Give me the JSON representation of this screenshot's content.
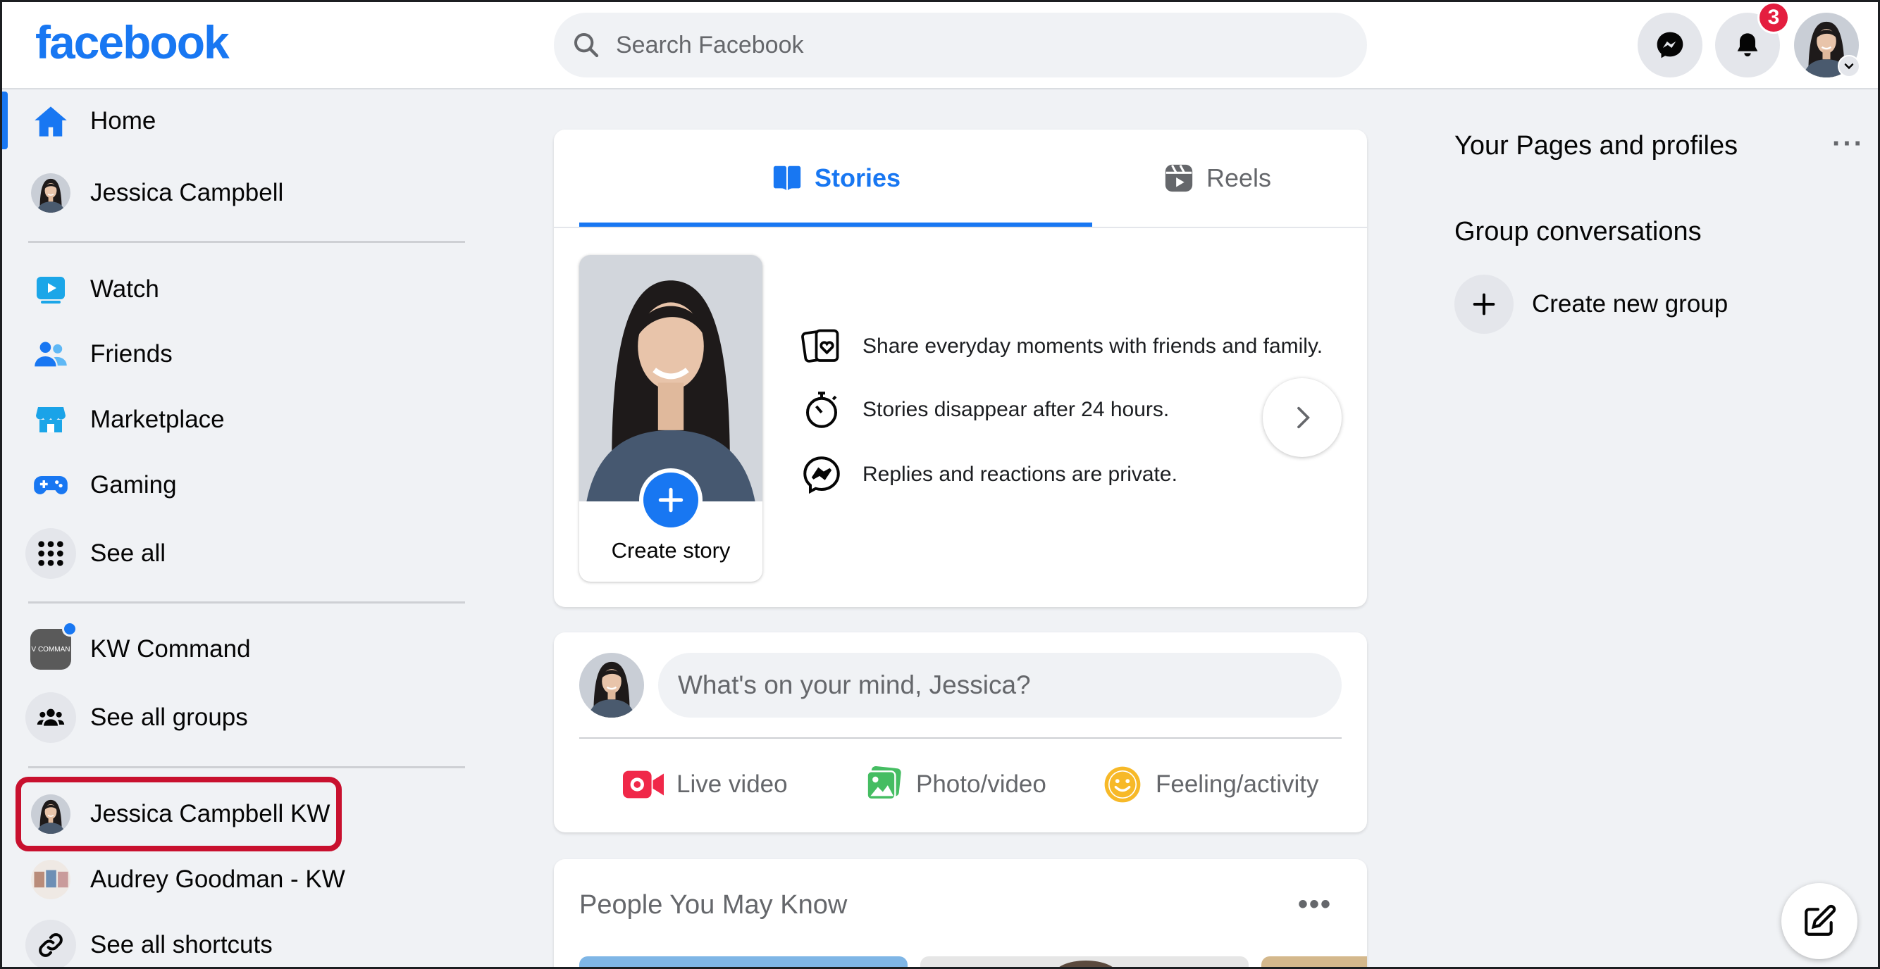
{
  "header": {
    "logo": "facebook",
    "search_placeholder": "Search Facebook",
    "notification_count": "3"
  },
  "sidebar": {
    "items": [
      {
        "label": "Home",
        "icon": "home-icon"
      },
      {
        "label": "Jessica Campbell",
        "icon": "avatar"
      },
      {
        "label": "Watch",
        "icon": "watch-icon"
      },
      {
        "label": "Friends",
        "icon": "friends-icon"
      },
      {
        "label": "Marketplace",
        "icon": "marketplace-icon"
      },
      {
        "label": "Gaming",
        "icon": "gaming-icon"
      },
      {
        "label": "See all",
        "icon": "grid-icon"
      }
    ],
    "groups": [
      {
        "label": "KW Command",
        "thumb_text": "V COMMAN"
      },
      {
        "label": "See all groups",
        "icon": "groups-icon"
      }
    ],
    "shortcuts": [
      {
        "label": "Jessica Campbell KW"
      },
      {
        "label": "Audrey Goodman - KW"
      },
      {
        "label": "See all shortcuts",
        "icon": "link-icon"
      }
    ]
  },
  "stories": {
    "tabs": [
      {
        "label": "Stories",
        "active": true
      },
      {
        "label": "Reels",
        "active": false
      }
    ],
    "create_label": "Create story",
    "info": [
      "Share everyday moments with friends and family.",
      "Stories disappear after 24 hours.",
      "Replies and reactions are private."
    ]
  },
  "composer": {
    "placeholder": "What's on your mind, Jessica?",
    "actions": [
      {
        "label": "Live video",
        "color": "#f02849"
      },
      {
        "label": "Photo/video",
        "color": "#45bd62"
      },
      {
        "label": "Feeling/activity",
        "color": "#f7b928"
      }
    ]
  },
  "pymk": {
    "title": "People You May Know",
    "more": "•••"
  },
  "right": {
    "pages_title": "Your Pages and profiles",
    "more": "···",
    "group_title": "Group conversations",
    "create_group": "Create new group"
  },
  "colors": {
    "brand": "#1877f2",
    "highlight": "#c8102e"
  }
}
